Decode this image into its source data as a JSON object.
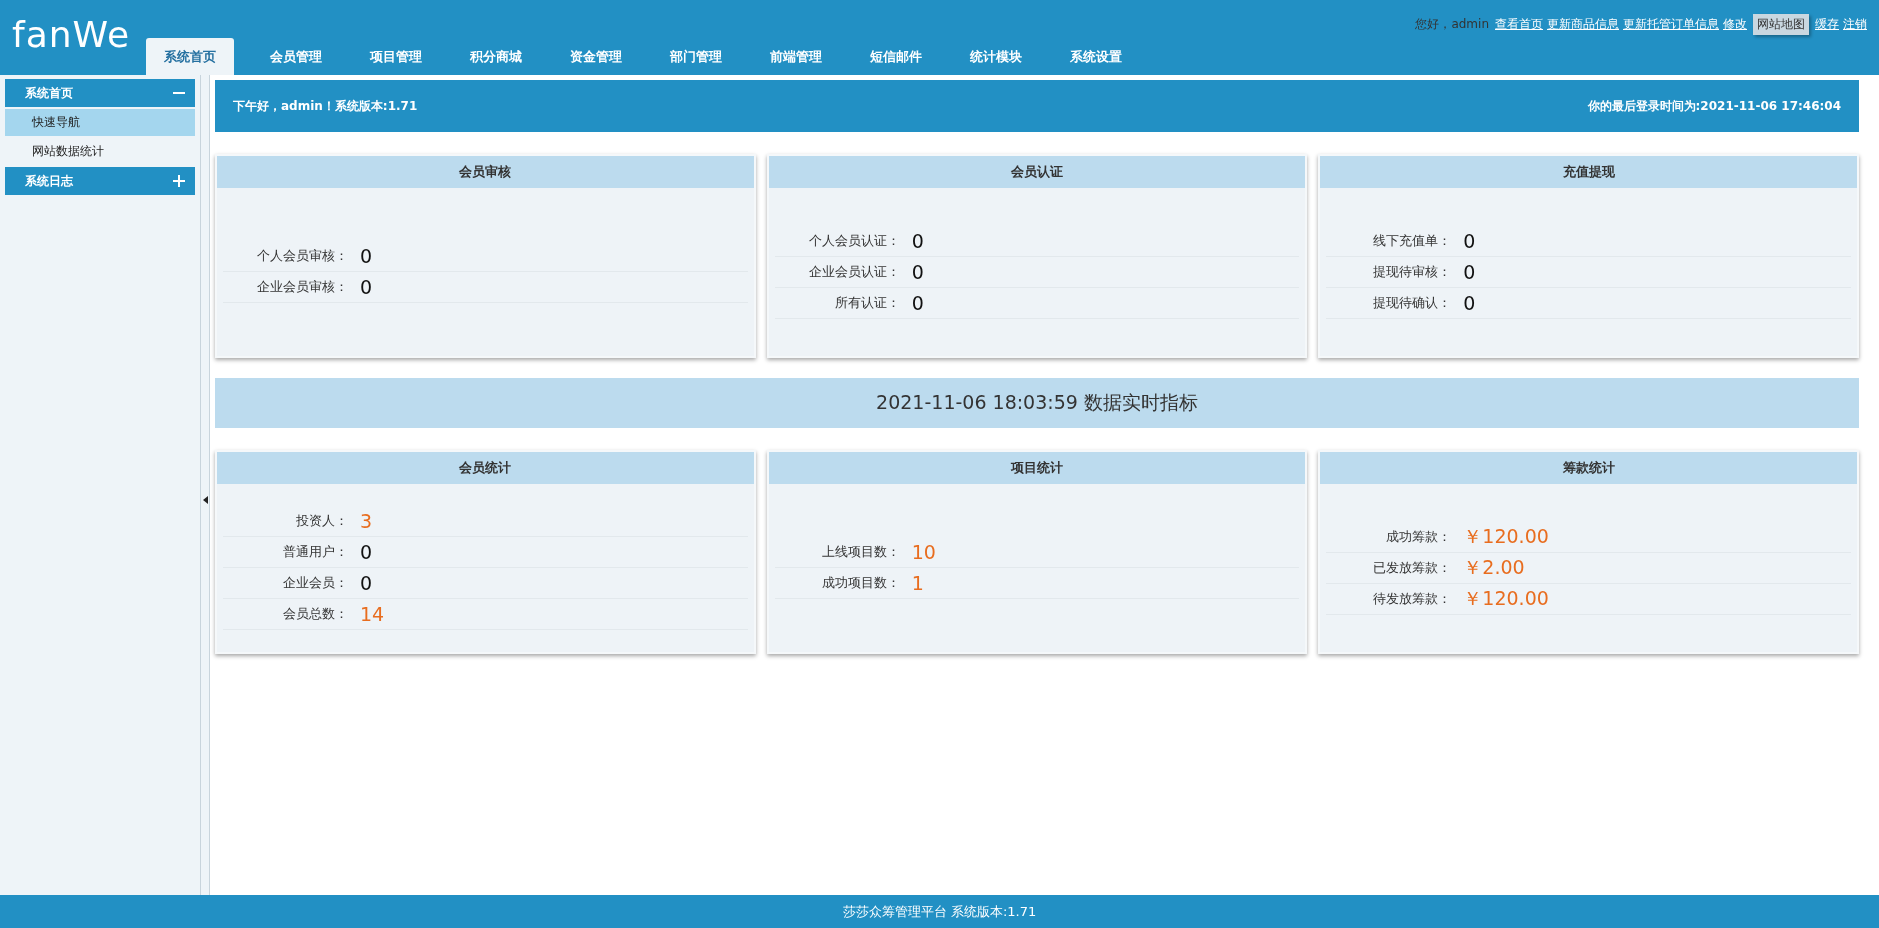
{
  "header": {
    "logo": "fanWe",
    "greeting": "您好，admin",
    "links": [
      "查看首页",
      "更新商品信息",
      "更新托管订单信息",
      "修改",
      "缓存",
      "注销"
    ],
    "tooltip": "网站地图"
  },
  "tabs": [
    {
      "label": "系统首页",
      "selected": true
    },
    {
      "label": "会员管理",
      "selected": false
    },
    {
      "label": "项目管理",
      "selected": false
    },
    {
      "label": "积分商城",
      "selected": false
    },
    {
      "label": "资金管理",
      "selected": false
    },
    {
      "label": "部门管理",
      "selected": false
    },
    {
      "label": "前端管理",
      "selected": false
    },
    {
      "label": "短信邮件",
      "selected": false
    },
    {
      "label": "统计模块",
      "selected": false
    },
    {
      "label": "系统设置",
      "selected": false
    }
  ],
  "sidebar": {
    "groups": [
      {
        "title": "系统首页",
        "expanded": true,
        "items": [
          {
            "label": "快速导航",
            "selected": true
          },
          {
            "label": "网站数据统计",
            "selected": false
          }
        ]
      },
      {
        "title": "系统日志",
        "expanded": false
      }
    ]
  },
  "welcome_bar": {
    "greeting": "下午好，admin！系统版本:1.71",
    "last_login": "你的最后登录时间为:2021-11-06 17:46:04"
  },
  "top_cards": [
    {
      "title": "会员审核",
      "rows": [
        {
          "label": "个人会员审核：",
          "value": "0",
          "highlight": false
        },
        {
          "label": "企业会员审核：",
          "value": "0",
          "highlight": false
        }
      ]
    },
    {
      "title": "会员认证",
      "rows": [
        {
          "label": "个人会员认证：",
          "value": "0",
          "highlight": false
        },
        {
          "label": "企业会员认证：",
          "value": "0",
          "highlight": false
        },
        {
          "label": "所有认证：",
          "value": "0",
          "highlight": false
        }
      ]
    },
    {
      "title": "充值提现",
      "rows": [
        {
          "label": "线下充值单：",
          "value": "0",
          "highlight": false
        },
        {
          "label": "提现待审核：",
          "value": "0",
          "highlight": false
        },
        {
          "label": "提现待确认：",
          "value": "0",
          "highlight": false
        }
      ]
    }
  ],
  "realtime_banner": "2021-11-06 18:03:59 数据实时指标",
  "bottom_cards": [
    {
      "title": "会员统计",
      "rows": [
        {
          "label": "投资人：",
          "value": "3",
          "highlight": true
        },
        {
          "label": "普通用户：",
          "value": "0",
          "highlight": false
        },
        {
          "label": "企业会员：",
          "value": "0",
          "highlight": false
        },
        {
          "label": "会员总数：",
          "value": "14",
          "highlight": true
        }
      ]
    },
    {
      "title": "项目统计",
      "rows": [
        {
          "label": "上线项目数：",
          "value": "10",
          "highlight": true
        },
        {
          "label": "成功项目数：",
          "value": "1",
          "highlight": true
        }
      ]
    },
    {
      "title": "筹款统计",
      "rows": [
        {
          "label": "成功筹款：",
          "value": "￥120.00",
          "highlight": true
        },
        {
          "label": "已发放筹款：",
          "value": "￥2.00",
          "highlight": true
        },
        {
          "label": "待发放筹款：",
          "value": "￥120.00",
          "highlight": true
        }
      ]
    }
  ],
  "footer": "莎莎众筹管理平台 系统版本:1.71"
}
